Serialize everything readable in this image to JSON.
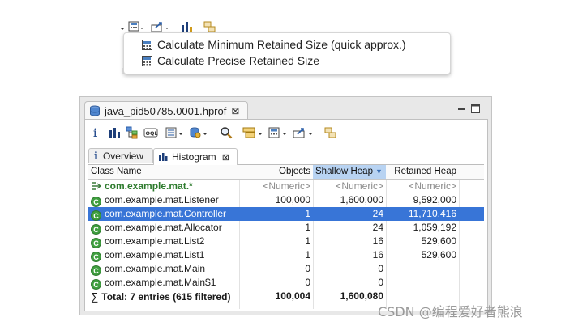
{
  "top_toolbar": {
    "icons": [
      "query-browser-icon",
      "calculate-retained-size-icon",
      "export-icon",
      "histogram-icon",
      "compare-icon"
    ]
  },
  "menu": {
    "items": [
      {
        "label": "Calculate Minimum Retained Size (quick approx.)",
        "icon": "calculator-icon"
      },
      {
        "label": "Calculate Precise Retained Size",
        "icon": "calculator-icon"
      }
    ]
  },
  "editor": {
    "tab_label": "java_pid50785.0001.hprof",
    "tab_close": "⊠",
    "inner_tabs": [
      {
        "icon": "i",
        "label": "Overview"
      },
      {
        "icon": "histogram",
        "label": "Histogram",
        "close": "⊠"
      }
    ]
  },
  "table": {
    "columns": [
      "Class Name",
      "Objects",
      "Shallow Heap",
      "Retained Heap"
    ],
    "sort_column": "Shallow Heap",
    "filter_row": {
      "name": "com.example.mat.*",
      "objects": "<Numeric>",
      "shallow": "<Numeric>",
      "retained": "<Numeric>"
    },
    "rows": [
      {
        "name": "com.example.mat.Listener",
        "objects": "100,000",
        "shallow": "1,600,000",
        "retained": "9,592,000",
        "selected": false
      },
      {
        "name": "com.example.mat.Controller",
        "objects": "1",
        "shallow": "24",
        "retained": "11,710,416",
        "selected": true
      },
      {
        "name": "com.example.mat.Allocator",
        "objects": "1",
        "shallow": "24",
        "retained": "1,059,192",
        "selected": false
      },
      {
        "name": "com.example.mat.List2",
        "objects": "1",
        "shallow": "16",
        "retained": "529,600",
        "selected": false
      },
      {
        "name": "com.example.mat.List1",
        "objects": "1",
        "shallow": "16",
        "retained": "529,600",
        "selected": false
      },
      {
        "name": "com.example.mat.Main",
        "objects": "0",
        "shallow": "0",
        "retained": "",
        "selected": false
      },
      {
        "name": "com.example.mat.Main$1",
        "objects": "0",
        "shallow": "0",
        "retained": "",
        "selected": false
      }
    ],
    "total": {
      "label": "Total: 7 entries (615 filtered)",
      "objects": "100,004",
      "shallow": "1,600,080",
      "retained": ""
    }
  },
  "watermark": "CSDN @编程爱好者熊浪",
  "colors": {
    "selection": "#3875d7",
    "sorted_header": "#b8d3f2",
    "class_icon": "#3f9f3f"
  }
}
